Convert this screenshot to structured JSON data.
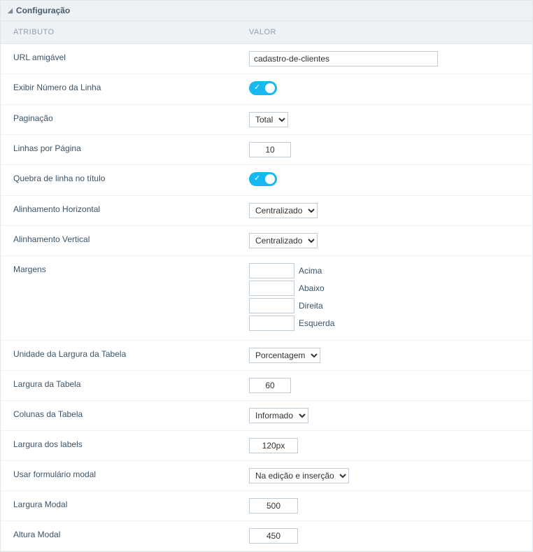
{
  "panel": {
    "title": "Configuração"
  },
  "columns": {
    "attr": "ATRIBUTO",
    "val": "VALOR"
  },
  "rows": {
    "url_friendly": {
      "label": "URL amigável",
      "value": "cadastro-de-clientes"
    },
    "show_line_number": {
      "label": "Exibir Número da Linha"
    },
    "pagination": {
      "label": "Paginação",
      "value": "Total"
    },
    "lines_per_page": {
      "label": "Linhas por Página",
      "value": "10"
    },
    "title_line_break": {
      "label": "Quebra de linha no título"
    },
    "h_align": {
      "label": "Alinhamento Horizontal",
      "value": "Centralizado"
    },
    "v_align": {
      "label": "Alinhamento Vertical",
      "value": "Centralizado"
    },
    "margins": {
      "label": "Margens",
      "top": {
        "value": "",
        "text": "Acima"
      },
      "bottom": {
        "value": "",
        "text": "Abaixo"
      },
      "right": {
        "value": "",
        "text": "Direita"
      },
      "left": {
        "value": "",
        "text": "Esquerda"
      }
    },
    "table_width_unit": {
      "label": "Unidade da Largura da Tabela",
      "value": "Porcentagem"
    },
    "table_width": {
      "label": "Largura da Tabela",
      "value": "60"
    },
    "table_columns": {
      "label": "Colunas da Tabela",
      "value": "Informado"
    },
    "labels_width": {
      "label": "Largura dos labels",
      "value": "120px"
    },
    "use_modal": {
      "label": "Usar formulário modal",
      "value": "Na edição e inserção"
    },
    "modal_width": {
      "label": "Largura Modal",
      "value": "500"
    },
    "modal_height": {
      "label": "Altura Modal",
      "value": "450"
    }
  }
}
